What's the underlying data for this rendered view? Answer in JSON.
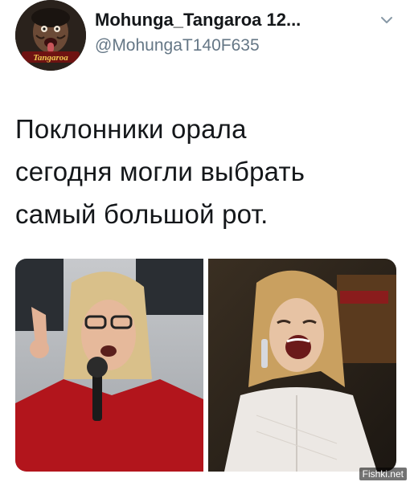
{
  "tweet": {
    "author": {
      "display_name": "Mohunga_Tangaroa 12...",
      "handle": "@MohungaT140F635",
      "avatar_icon": "avatar-photo",
      "avatar_caption": "Tangaroa"
    },
    "menu_icon": "chevron-down-icon",
    "text_lines": [
      "Поклонники орала",
      "сегодня могли выбрать",
      "самый большой рот."
    ],
    "media": [
      {
        "name": "photo-left",
        "description_icon": "photo"
      },
      {
        "name": "photo-right",
        "description_icon": "photo"
      }
    ]
  },
  "watermark": "Fishki.net",
  "colors": {
    "text": "#14171a",
    "secondary": "#657786",
    "background": "#ffffff"
  }
}
